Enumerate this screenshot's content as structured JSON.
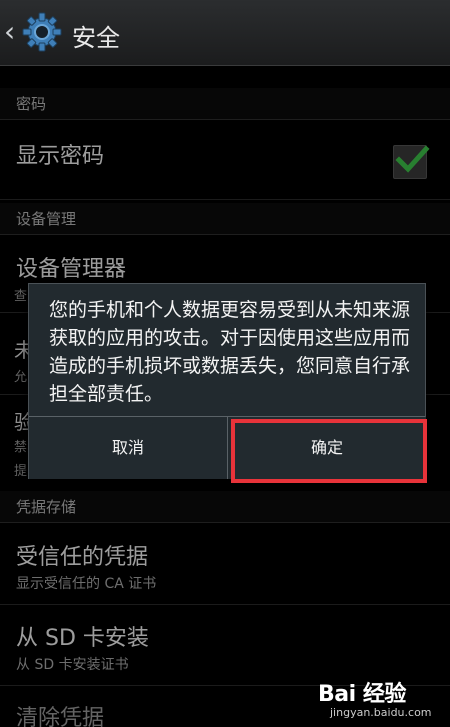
{
  "header": {
    "title": "安全"
  },
  "sections": {
    "password": {
      "header": "密码",
      "show_password": "显示密码",
      "show_password_checked": true
    },
    "device_admin": {
      "header": "设备管理",
      "device_admins_title": "设备管理器"
    },
    "credentials": {
      "header": "凭据存储",
      "trusted_title": "受信任的凭据",
      "trusted_sub": "显示受信任的 CA 证书",
      "sd_title": "从 SD 卡安装",
      "sd_sub": "从 SD 卡安装证书",
      "clear_title": "清除凭据"
    }
  },
  "dialog": {
    "message": "您的手机和个人数据更容易受到从未知来源获取的应用的攻击。对于因使用这些应用而造成的手机损坏或数据丢失，您同意自行承担全部责任。",
    "cancel_label": "取消",
    "ok_label": "确定"
  },
  "watermark": {
    "brand": "Bai 经验",
    "url": "jingyan.baidu.com"
  },
  "colors": {
    "highlight": "#e8333a",
    "check": "#3ec44a"
  }
}
